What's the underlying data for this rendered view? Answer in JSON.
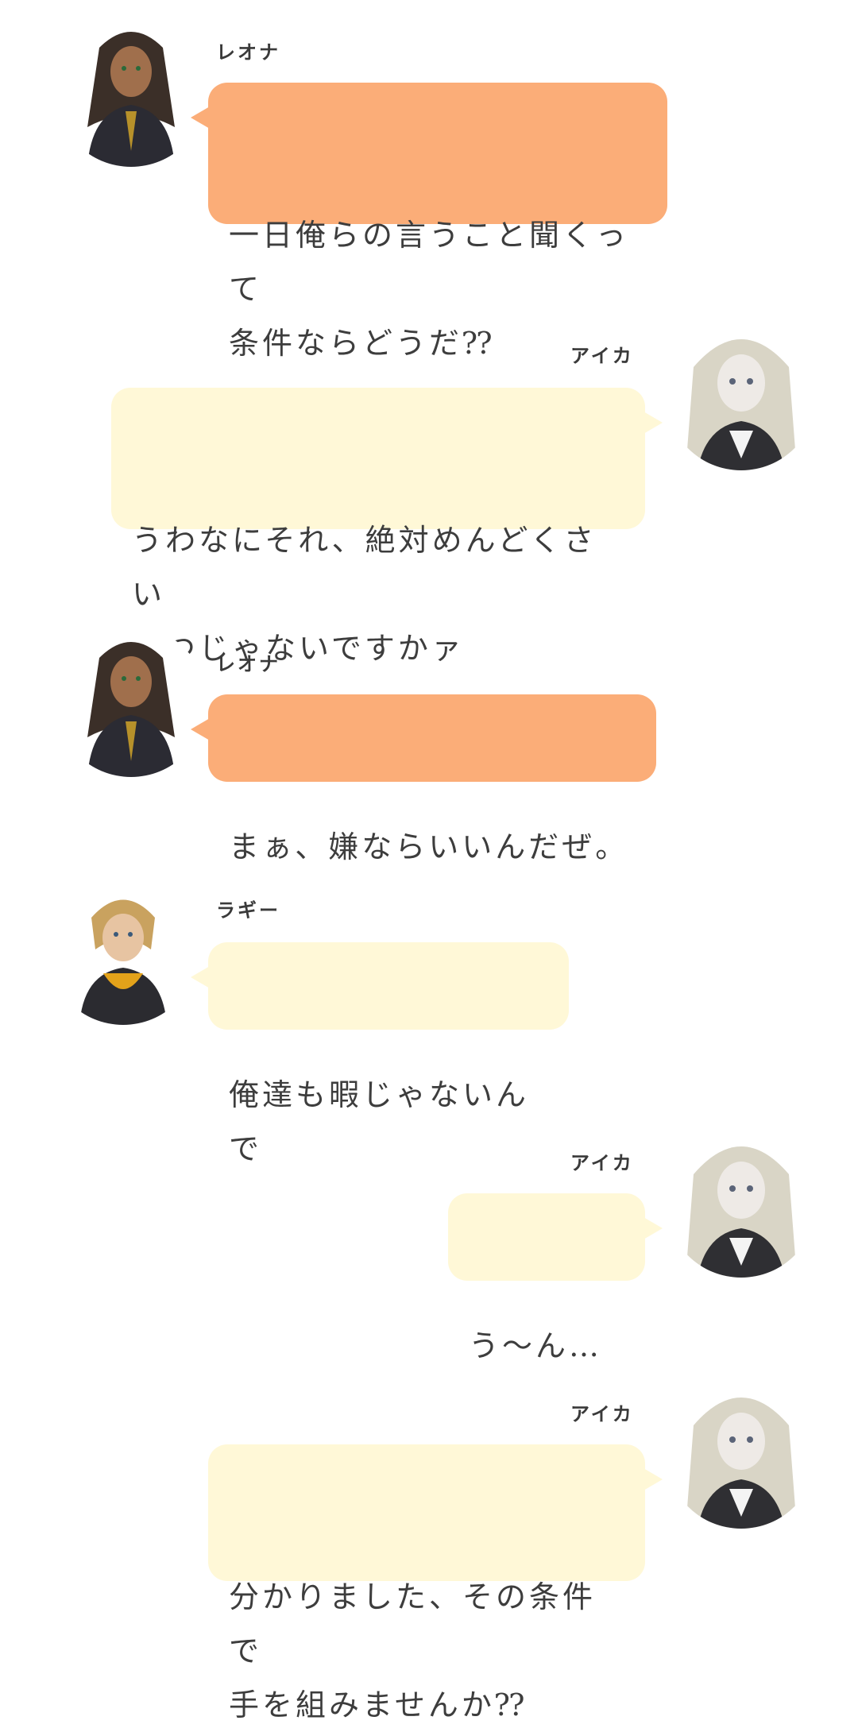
{
  "messages": [
    {
      "speaker": "レオナ",
      "text": "一日俺らの言うこと聞くって\n条件ならどうだ⁇"
    },
    {
      "speaker": "アイカ",
      "text": "うわなにそれ、絶対めんどくさい\nやつじゃないですかァ"
    },
    {
      "speaker": "レオナ",
      "text": "まぁ、嫌ならいいんだぜ。"
    },
    {
      "speaker": "ラギー",
      "text": "俺達も暇じゃないんで"
    },
    {
      "speaker": "アイカ",
      "text": "う～ん…"
    },
    {
      "speaker": "アイカ",
      "text": "分かりました、その条件で\n手を組みませんか⁇"
    }
  ],
  "avatars": {
    "leona": "leona-avatar",
    "aika": "aika-avatar",
    "ruggie": "ruggie-avatar"
  },
  "colors": {
    "leona_bubble": "#fbad78",
    "cream_bubble": "#fff8d7",
    "text": "#3d3d3d"
  }
}
